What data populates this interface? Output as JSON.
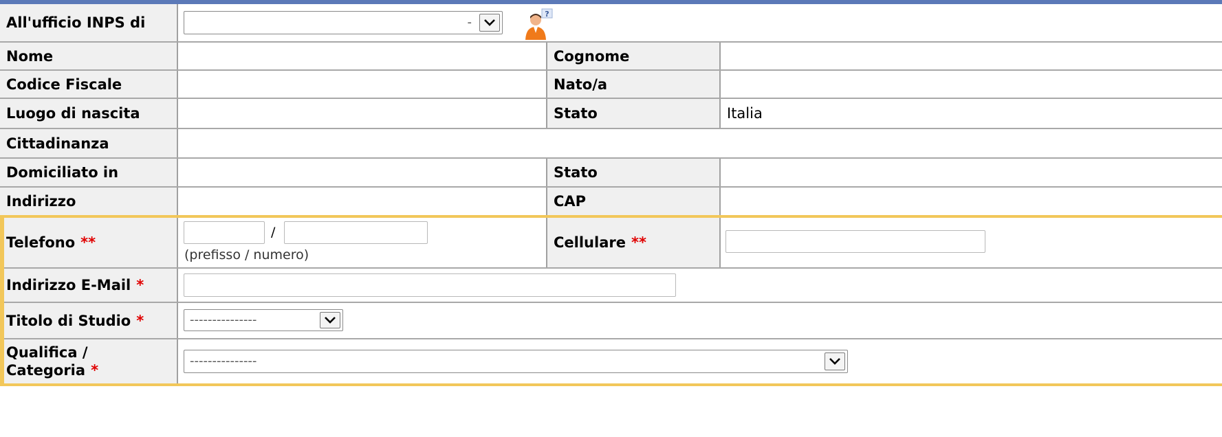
{
  "office": {
    "label": "All'ufficio INPS di",
    "dash": "-",
    "help_icon": "help-person-icon"
  },
  "rows": {
    "nome_label": "Nome",
    "cognome_label": "Cognome",
    "cf_label": "Codice Fiscale",
    "nato_label": "Nato/a",
    "luogo_label": "Luogo di nascita",
    "stato1_label": "Stato",
    "stato1_value": "Italia",
    "cittadinanza_label": "Cittadinanza",
    "domiciliato_label": "Domiciliato in",
    "stato2_label": "Stato",
    "indirizzo_label": "Indirizzo",
    "cap_label": "CAP"
  },
  "contacts": {
    "telefono_label": "Telefono",
    "telefono_req": "**",
    "slash": "/",
    "telefono_hint": "(prefisso / numero)",
    "cellulare_label": "Cellulare",
    "cellulare_req": "**",
    "email_label": "Indirizzo E-Mail",
    "email_req": "*",
    "titolo_label": "Titolo di Studio",
    "titolo_req": "*",
    "titolo_value": "---------------",
    "qualifica_label_1": "Qualifica /",
    "qualifica_label_2": "Categoria",
    "qualifica_req": "*",
    "qualifica_value": "---------------"
  },
  "colors": {
    "header_bar": "#5b79b8",
    "label_bg": "#f0f0f0",
    "required_star": "#e00000",
    "highlight_border": "#f2c75a"
  }
}
